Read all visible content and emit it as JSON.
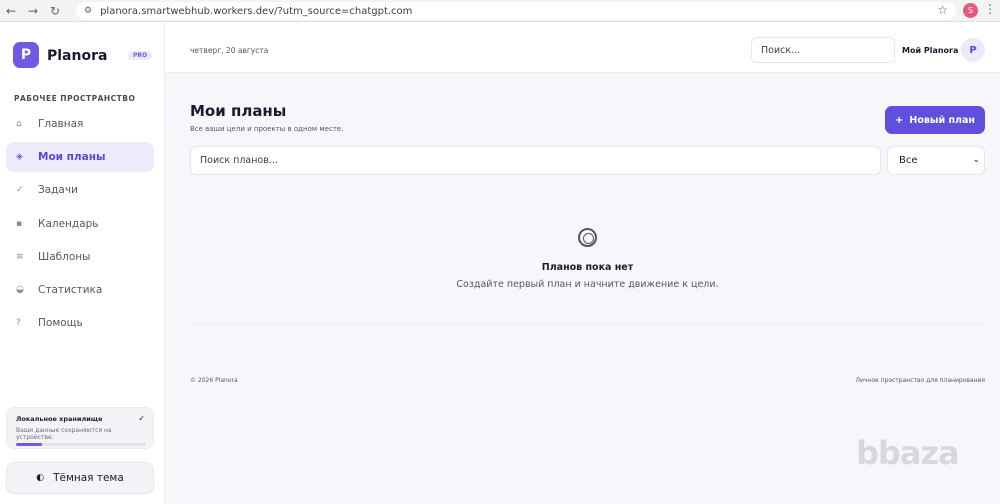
{
  "browser": {
    "url": "planora.smartwebhub.workers.dev/?utm_source=chatgpt.com",
    "profile_initial": "S"
  },
  "sidebar": {
    "logo_initial": "P",
    "app_name": "Planora",
    "badge": "PRO",
    "section_title": "РАБОЧЕЕ ПРОСТРАНСТВО",
    "items": [
      {
        "label": "Главная",
        "icon": "home-icon",
        "glyph": "⌂",
        "active": false
      },
      {
        "label": "Мои планы",
        "icon": "diamond-icon",
        "glyph": "◈",
        "active": true
      },
      {
        "label": "Задачи",
        "icon": "check-icon",
        "glyph": "✓",
        "active": false
      },
      {
        "label": "Календарь",
        "icon": "calendar-icon",
        "glyph": "▪",
        "active": false
      },
      {
        "label": "Шаблоны",
        "icon": "list-icon",
        "glyph": "≡",
        "active": false
      },
      {
        "label": "Статистика",
        "icon": "pie-chart-icon",
        "glyph": "◒",
        "active": false
      },
      {
        "label": "Помощь",
        "icon": "help-icon",
        "glyph": "?",
        "active": false
      }
    ],
    "storage": {
      "title": "Локальное хранилище",
      "description": "Ваши данные сохраняются на устройстве.",
      "progress_percent": 20
    },
    "theme_button": "Тёмная тема"
  },
  "header": {
    "date": "четверг, 20 августа",
    "search_placeholder": "Поиск...",
    "username": "Мой Planora",
    "avatar_initial": "P"
  },
  "main": {
    "title": "Мои планы",
    "subtitle": "Все ваши цели и проекты в одном месте.",
    "new_button": "Новый план",
    "search_placeholder": "Поиск планов...",
    "filter_selected": "Все",
    "empty_title": "Планов пока нет",
    "empty_description": "Создайте первый план и начните движение к цели."
  },
  "footer": {
    "left": "© 2026 Planora",
    "right": "Личное пространство для планирования"
  },
  "watermark": "bbaza",
  "colors": {
    "accent": "#6d5be6",
    "accent_button": "#5f4fdc"
  }
}
